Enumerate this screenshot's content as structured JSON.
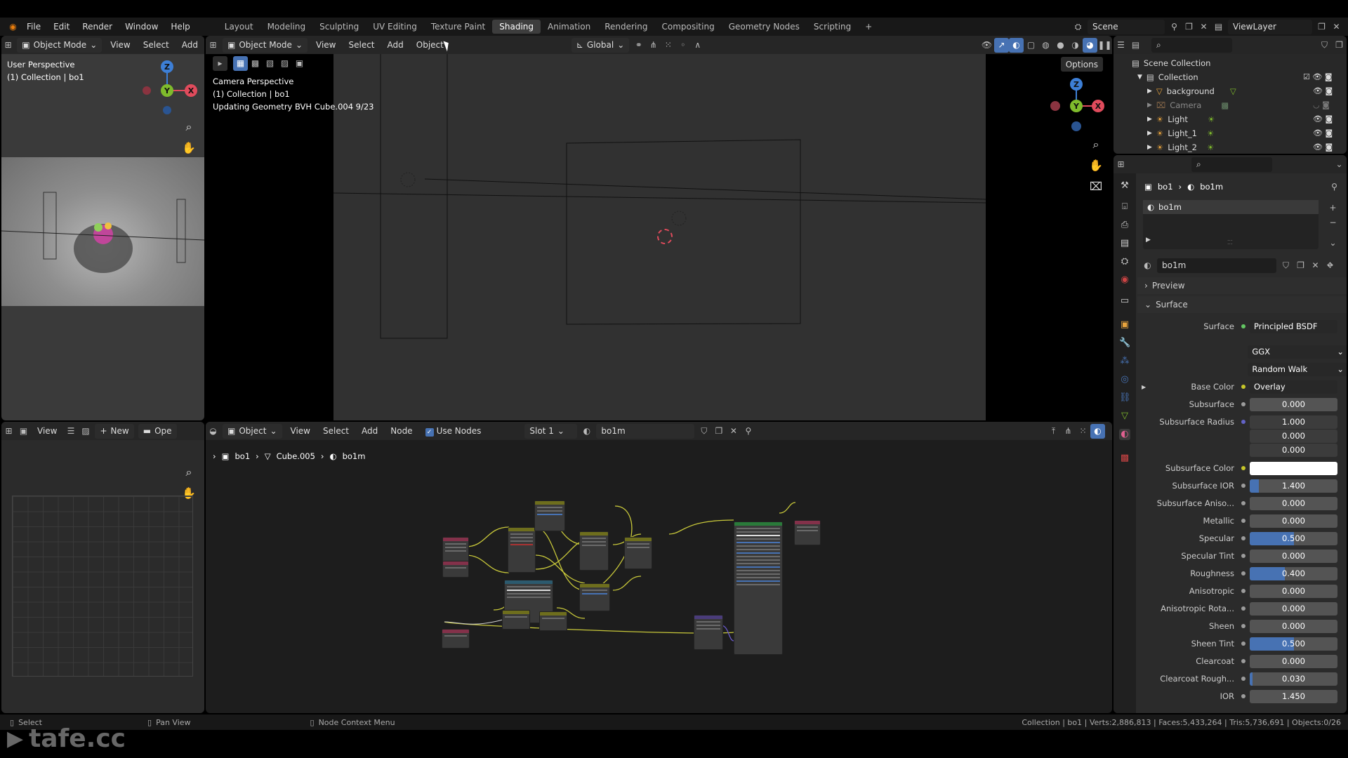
{
  "topbar": {
    "menus": [
      "File",
      "Edit",
      "Render",
      "Window",
      "Help"
    ],
    "workspaces": [
      "Layout",
      "Modeling",
      "Sculpting",
      "UV Editing",
      "Texture Paint",
      "Shading",
      "Animation",
      "Rendering",
      "Compositing",
      "Geometry Nodes",
      "Scripting"
    ],
    "active_workspace": "Shading",
    "add_workspace": "+",
    "scene": "Scene",
    "view_layer": "ViewLayer"
  },
  "left_viewport": {
    "mode": "Object Mode",
    "menus": [
      "View",
      "Select",
      "Add"
    ],
    "overlay_line1": "User Perspective",
    "overlay_line2": "(1) Collection | bo1"
  },
  "main_viewport": {
    "mode": "Object Mode",
    "menus": [
      "View",
      "Select",
      "Add",
      "Object"
    ],
    "orientation": "Global",
    "options_label": "Options",
    "overlay_line1": "Camera Perspective",
    "overlay_line2": "(1) Collection | bo1",
    "overlay_line3": "Updating Geometry BVH Cube.004 9/23"
  },
  "image_editor": {
    "view_label": "View",
    "new_label": "New",
    "open_label": "Ope"
  },
  "node_editor": {
    "type_label": "Object",
    "menus": [
      "View",
      "Select",
      "Add",
      "Node"
    ],
    "use_nodes": "Use Nodes",
    "slot": "Slot 1",
    "material": "bo1m",
    "breadcrumb": [
      "bo1",
      "Cube.005",
      "bo1m"
    ]
  },
  "outliner": {
    "root": "Scene Collection",
    "items": [
      {
        "name": "Collection",
        "indent": 0
      },
      {
        "name": "background",
        "indent": 1
      },
      {
        "name": "Camera",
        "indent": 1
      },
      {
        "name": "Light",
        "indent": 1
      },
      {
        "name": "Light_1",
        "indent": 1
      },
      {
        "name": "Light_2",
        "indent": 1
      }
    ]
  },
  "properties": {
    "breadcrumb_object": "bo1",
    "breadcrumb_material": "bo1m",
    "slot_material": "bo1m",
    "material_name": "bo1m",
    "preview_label": "Preview",
    "surface_section": "Surface",
    "surface_label": "Surface",
    "surface_value": "Principled BSDF",
    "distribution": "GGX",
    "subsurface_method": "Random Walk",
    "base_color_label": "Base Color",
    "base_color_value": "Overlay",
    "subsurface_radius_label": "Subsurface Radius",
    "subsurface_radius": [
      "1.000",
      "0.000",
      "0.000"
    ],
    "subsurface_color_label": "Subsurface Color",
    "fields": [
      {
        "label": "Subsurface",
        "value": "0.000",
        "fill": 0
      },
      {
        "label": "Subsurface IOR",
        "value": "1.400",
        "fill": 0.1
      },
      {
        "label": "Subsurface Aniso...",
        "value": "0.000",
        "fill": 0
      },
      {
        "label": "Metallic",
        "value": "0.000",
        "fill": 0
      },
      {
        "label": "Specular",
        "value": "0.500",
        "fill": 0.5
      },
      {
        "label": "Specular Tint",
        "value": "0.000",
        "fill": 0
      },
      {
        "label": "Roughness",
        "value": "0.400",
        "fill": 0.4
      },
      {
        "label": "Anisotropic",
        "value": "0.000",
        "fill": 0
      },
      {
        "label": "Anisotropic Rota...",
        "value": "0.000",
        "fill": 0
      },
      {
        "label": "Sheen",
        "value": "0.000",
        "fill": 0
      },
      {
        "label": "Sheen Tint",
        "value": "0.500",
        "fill": 0.5
      },
      {
        "label": "Clearcoat",
        "value": "0.000",
        "fill": 0
      },
      {
        "label": "Clearcoat Rough...",
        "value": "0.030",
        "fill": 0.03
      },
      {
        "label": "IOR",
        "value": "1.450",
        "fill": 0
      }
    ]
  },
  "statusbar": {
    "select": "Select",
    "pan": "Pan View",
    "context": "Node Context Menu",
    "stats": "Collection | bo1 | Verts:2,886,813 | Faces:5,433,264 | Tris:5,736,691 | Objects:0/26"
  },
  "watermark": "tafe.cc",
  "colors": {
    "accent": "#4772b3",
    "x_axis": "#e04b5c",
    "y_axis": "#7fbb2c",
    "z_axis": "#3d7fd6"
  }
}
